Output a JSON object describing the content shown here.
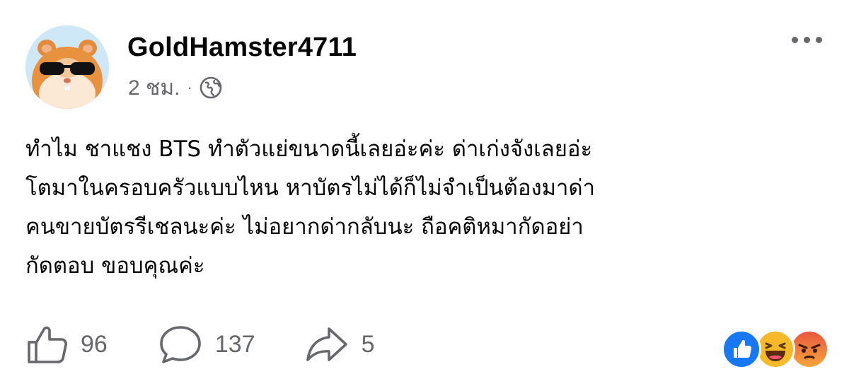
{
  "post": {
    "author": "GoldHamster4711",
    "time": "2 ชม.",
    "separator": "·",
    "privacy_icon": "globe-icon",
    "text_lines": [
      "ทำไม ชาแชง BTS ทำตัวแย่ขนาดนี้เลยอ่ะค่ะ ด่าเก่งจังเลยอ่ะ",
      "โตมาในครอบครัวแบบไหน หาบัตรไม่ได้ก็ไม่จำเป็นต้องมาด่า",
      "คนขายบัตรรีเชลนะค่ะ ไม่อยากด่ากลับนะ ถือคติหมากัดอย่า",
      "กัดตอบ  ขอบคุณค่ะ"
    ]
  },
  "actions": {
    "like": {
      "icon": "thumbs-up-icon",
      "count": "96"
    },
    "comment": {
      "icon": "comment-bubble-icon",
      "count": "137"
    },
    "share": {
      "icon": "share-arrow-icon",
      "count": "5"
    }
  },
  "reactions": [
    "like",
    "haha",
    "angry"
  ],
  "colors": {
    "text": "#050505",
    "secondary": "#65676b",
    "like_blue": "#1877f2",
    "haha_yellow": "#f7b928",
    "angry_red": "#e9573f"
  }
}
